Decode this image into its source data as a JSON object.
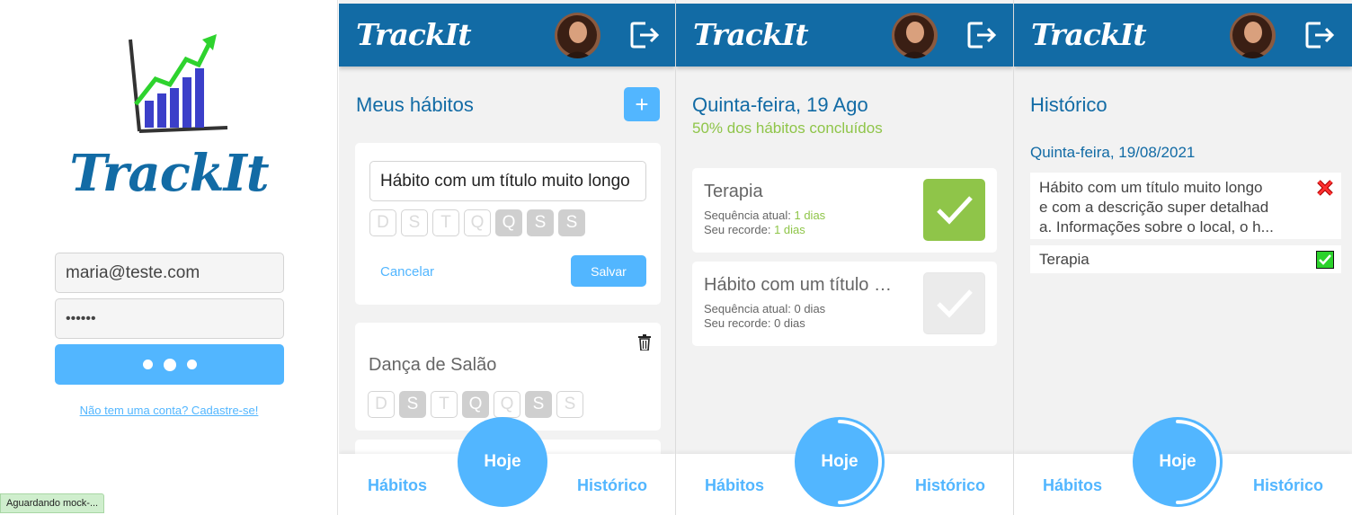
{
  "login": {
    "brand": "TrackIt",
    "email_value": "maria@teste.com",
    "password_value": "••••••",
    "signup_link": "Não tem uma conta? Cadastre-se!",
    "status_text": "Aguardando mock-..."
  },
  "header": {
    "brand": "TrackIt"
  },
  "footer": {
    "habits_label": "Hábitos",
    "today_label": "Hoje",
    "history_label": "Histórico"
  },
  "habits_page": {
    "title": "Meus hábitos",
    "add_label": "+",
    "new_habit_value": "Hábito com um título muito longo",
    "weekdays": [
      "D",
      "S",
      "T",
      "Q",
      "Q",
      "S",
      "S"
    ],
    "new_habit_selected": [
      false,
      false,
      false,
      false,
      true,
      true,
      true
    ],
    "cancel_label": "Cancelar",
    "save_label": "Salvar",
    "habits": [
      {
        "name": "Dança de Salão",
        "selected": [
          false,
          true,
          false,
          true,
          false,
          true,
          false
        ]
      }
    ]
  },
  "today_page": {
    "title": "Quinta-feira, 19 Ago",
    "subtitle": "50% dos hábitos concluídos",
    "progress": 0.5,
    "habits": [
      {
        "name": "Terapia",
        "streak_label": "Sequência atual:",
        "streak_value": "1 dias",
        "record_label": "Seu recorde:",
        "record_value": "1 dias",
        "done": true
      },
      {
        "name": "Hábito com um título muito longo",
        "streak_label": "Sequência atual:",
        "streak_value": "0 dias",
        "record_label": "Seu recorde:",
        "record_value": "0 dias",
        "done": false
      }
    ],
    "colors": {
      "done": "#8fc549",
      "pending": "#ebebeb"
    }
  },
  "history_page": {
    "title": "Histórico",
    "progress": 0.5,
    "date": "Quinta-feira, 19/08/2021",
    "items": [
      {
        "line1": "Hábito com um título muito longo",
        "line2": "e com a descrição super detalhad",
        "line3": "a. Informações sobre o local, o h...",
        "done": false
      },
      {
        "line1": "Terapia",
        "done": true
      }
    ]
  },
  "colors": {
    "primary_dark": "#126ba5",
    "primary_light": "#52b6ff",
    "success": "#8fc549",
    "background": "#f2f2f2"
  }
}
